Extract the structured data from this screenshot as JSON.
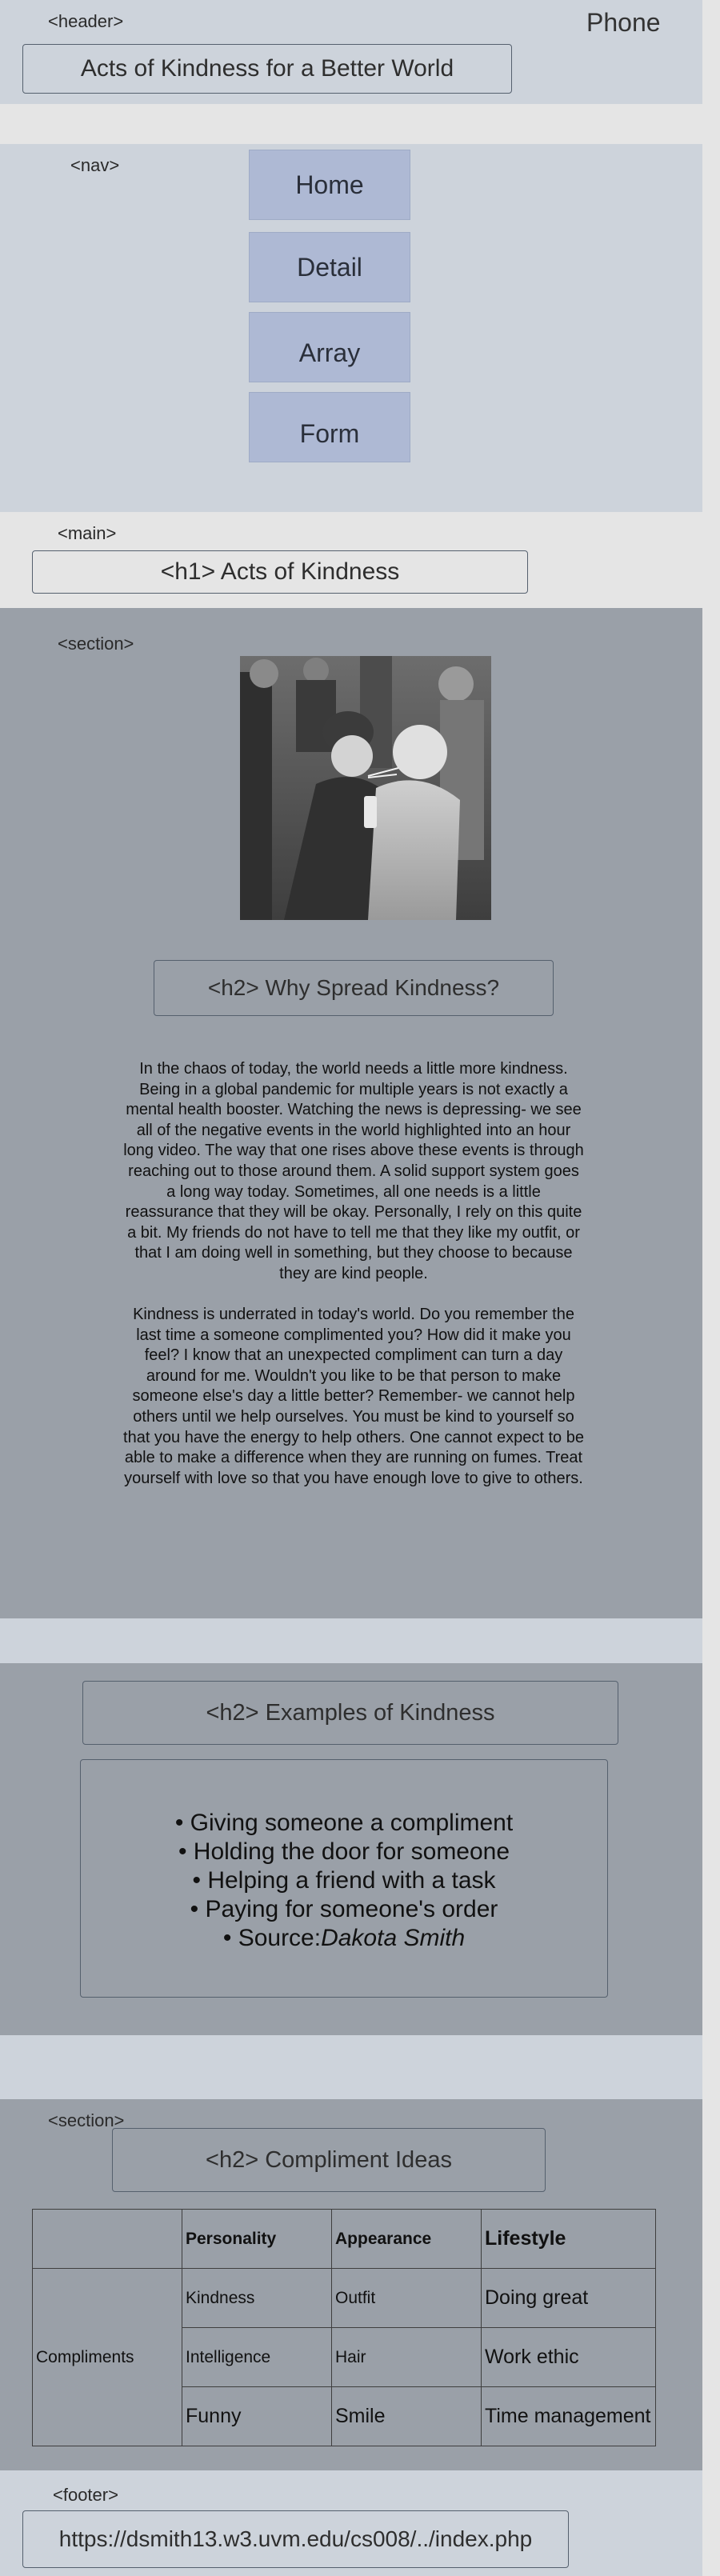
{
  "header": {
    "tag": "<header>",
    "device": "Phone",
    "title": "Acts of Kindness for a Better World"
  },
  "nav": {
    "tag": "<nav>",
    "items": [
      "Home",
      "Detail",
      "Array",
      "Form"
    ]
  },
  "main": {
    "tag": "<main>",
    "h1": "<h1> Acts of Kindness"
  },
  "section1": {
    "tag": "<section>",
    "photo_alt": "Two children sharing a drink with straws",
    "h2": "<h2> Why Spread Kindness?",
    "p1": "In the chaos of today, the world needs a little more kindness. Being in a global pandemic for multiple years is not exactly a mental health booster. Watching the news is depressing- we see all of the negative events in the world highlighted into an hour long video. The way that one rises above these events is through reaching out to those around them. A solid support system goes a long way today. Sometimes, all one needs is a little reassurance that they will be okay. Personally, I rely on this quite a bit. My friends do not have to tell me that they like my outfit, or that I am doing well in something, but they choose to because they are kind people.",
    "p2": "Kindness is underrated in today's world. Do you remember the last time a someone complimented you? How did it make you feel? I know that an unexpected compliment can turn a day around for me. Wouldn't you like to be that person to make someone else's day a little better? Remember- we cannot help others until we help ourselves. You must be kind to yourself so that you have the energy to help others. One cannot expect to be able to make a difference when they are running on fumes. Treat yourself with love so that you have enough love to give to others."
  },
  "section2": {
    "h2": "<h2> Examples of Kindness",
    "items": [
      "Giving someone a compliment",
      "Holding the door for someone",
      "Helping a friend with a task",
      "Paying for someone's order"
    ],
    "source_label": "Source:",
    "source_name": "Dakota Smith"
  },
  "section3": {
    "tag": "<section>",
    "h2": "<h2> Compliment Ideas",
    "table": {
      "headers": [
        "",
        "Personality",
        "Appearance",
        "Lifestyle"
      ],
      "row_label": "Compliments",
      "rows": [
        [
          "Kindness",
          "Outfit",
          "Doing great"
        ],
        [
          "Intelligence",
          "Hair",
          "Work ethic"
        ],
        [
          "Funny",
          "Smile",
          "Time management"
        ]
      ]
    }
  },
  "footer": {
    "tag": "<footer>",
    "url": "https://dsmith13.w3.uvm.edu/cs008/../index.php"
  },
  "colors": {
    "light_band": "#cdd3db",
    "gray_band": "#9aa0a8",
    "page_bg": "#e5e5e5",
    "nav_button": "#aeb9d4"
  }
}
